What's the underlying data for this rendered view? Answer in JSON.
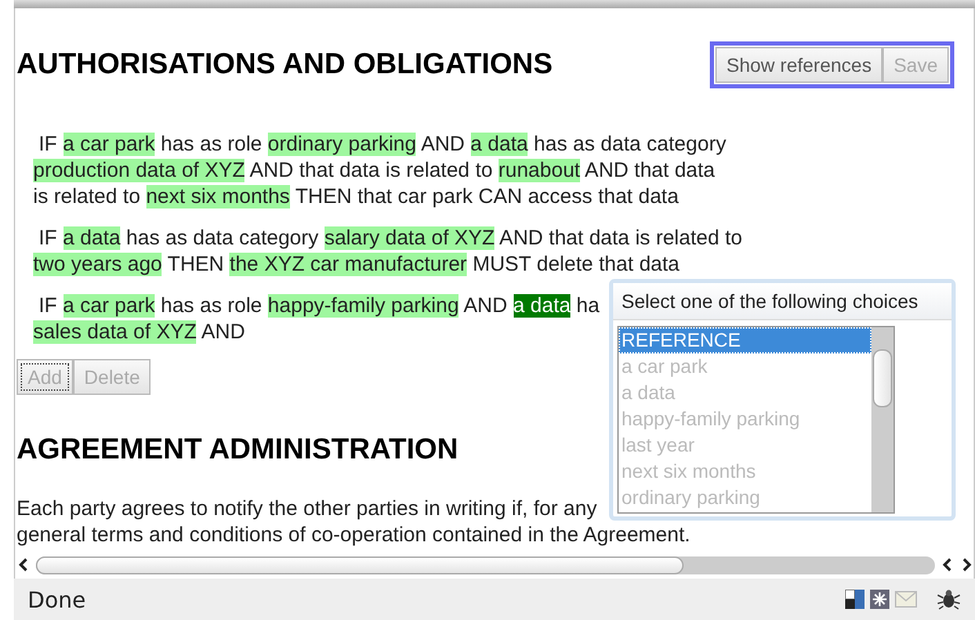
{
  "section_heading": "AUTHORISATIONS AND OBLIGATIONS",
  "toolbar_buttons": [
    {
      "label": "Show references",
      "disabled": false
    },
    {
      "label": "Save",
      "disabled": true
    }
  ],
  "rules": [
    {
      "lines": [
        [
          {
            "text": "IF ",
            "kind": "plain"
          },
          {
            "text": "a car park",
            "kind": "term"
          },
          {
            "text": " has as role ",
            "kind": "plain"
          },
          {
            "text": "ordinary parking",
            "kind": "term"
          },
          {
            "text": " AND ",
            "kind": "plain"
          },
          {
            "text": "a data",
            "kind": "term"
          },
          {
            "text": " has as data category",
            "kind": "plain"
          }
        ],
        [
          {
            "text": "production data of XYZ",
            "kind": "term"
          },
          {
            "text": " AND that data is related to ",
            "kind": "plain"
          },
          {
            "text": "runabout",
            "kind": "term"
          },
          {
            "text": " AND that data",
            "kind": "plain"
          }
        ],
        [
          {
            "text": "is related to ",
            "kind": "plain"
          },
          {
            "text": "next six months",
            "kind": "term"
          },
          {
            "text": " THEN that car park CAN access that data",
            "kind": "plain"
          }
        ]
      ]
    },
    {
      "lines": [
        [
          {
            "text": "IF ",
            "kind": "plain"
          },
          {
            "text": "a data",
            "kind": "term"
          },
          {
            "text": " has as data category ",
            "kind": "plain"
          },
          {
            "text": "salary data of XYZ",
            "kind": "term"
          },
          {
            "text": " AND that data is related to",
            "kind": "plain"
          }
        ],
        [
          {
            "text": "two years ago",
            "kind": "term"
          },
          {
            "text": " THEN ",
            "kind": "plain"
          },
          {
            "text": "the XYZ car manufacturer",
            "kind": "term"
          },
          {
            "text": " MUST delete that data",
            "kind": "plain"
          }
        ]
      ]
    },
    {
      "lines": [
        [
          {
            "text": "IF ",
            "kind": "plain"
          },
          {
            "text": "a car park",
            "kind": "term"
          },
          {
            "text": " has as role ",
            "kind": "plain"
          },
          {
            "text": "happy-family parking",
            "kind": "term"
          },
          {
            "text": " AND ",
            "kind": "plain"
          },
          {
            "text": "a data",
            "kind": "active"
          },
          {
            "text": " ha",
            "kind": "plain"
          }
        ],
        [
          {
            "text": "sales data of XYZ",
            "kind": "term"
          },
          {
            "text": " AND",
            "kind": "plain"
          }
        ]
      ]
    }
  ],
  "rule_buttons": [
    {
      "label": "Add",
      "disabled": true,
      "focused": true
    },
    {
      "label": "Delete",
      "disabled": true,
      "focused": false
    }
  ],
  "admin_heading": "AGREEMENT ADMINISTRATION",
  "admin_text": [
    "Each party agrees to notify the other parties in writing if, for any",
    "general terms and conditions of co-operation contained in the Agreement."
  ],
  "popup": {
    "title": "Select one of the following choices",
    "options": [
      {
        "label": "REFERENCE",
        "selected": true
      },
      {
        "label": "a car park",
        "selected": false
      },
      {
        "label": "a data",
        "selected": false
      },
      {
        "label": "happy-family parking",
        "selected": false
      },
      {
        "label": "last year",
        "selected": false
      },
      {
        "label": "next six months",
        "selected": false
      },
      {
        "label": "ordinary parking",
        "selected": false
      }
    ]
  },
  "status_bar": {
    "text": "Done"
  }
}
